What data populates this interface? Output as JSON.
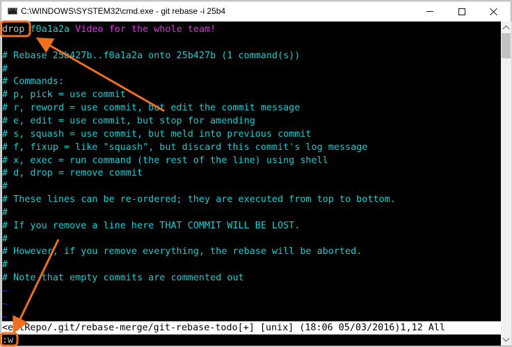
{
  "window": {
    "title": "C:\\WINDOWS\\SYSTEM32\\cmd.exe - git  rebase -i 25b4",
    "icon": "cmd-icon",
    "controls": {
      "minimize": "minimize-icon",
      "maximize": "maximize-icon",
      "close": "close-icon"
    }
  },
  "editor": {
    "first_line": {
      "command": "drop",
      "hash": "f0a1a2a",
      "message": "Video for the whole team!"
    },
    "comment_lines": [
      "",
      "# Rebase 25b427b..f0a1a2a onto 25b427b (1 command(s))",
      "#",
      "# Commands:",
      "# p, pick = use commit",
      "# r, reword = use commit, but edit the commit message",
      "# e, edit = use commit, but stop for amending",
      "# s, squash = use commit, but meld into previous commit",
      "# f, fixup = like \"squash\", but discard this commit's log message",
      "# x, exec = run command (the rest of the line) using shell",
      "# d, drop = remove commit",
      "#",
      "# These lines can be re-ordered; they are executed from top to bottom.",
      "#",
      "# If you remove a line here THAT COMMIT WILL BE LOST.",
      "#",
      "# However, if you remove everything, the rebase will be aborted.",
      "#",
      "# Note that empty commits are commented out"
    ],
    "empty_markers": [
      "~",
      "~",
      "~"
    ],
    "status_line": "<eitRepo/.git/rebase-merge/git-rebase-todo[+] [unix] (18:06 05/03/2016)1,12 All",
    "command_line": ":w"
  },
  "colors": {
    "terminal_bg": "#000000",
    "comment_text": "#11d0d6",
    "hash_text": "#11d0d6",
    "message_text": "#e52ee5",
    "tilde_text": "#2a2ae8",
    "annotation": "#f07020"
  },
  "annotations": {
    "highlight_1": "drop",
    "highlight_2": ":w"
  }
}
